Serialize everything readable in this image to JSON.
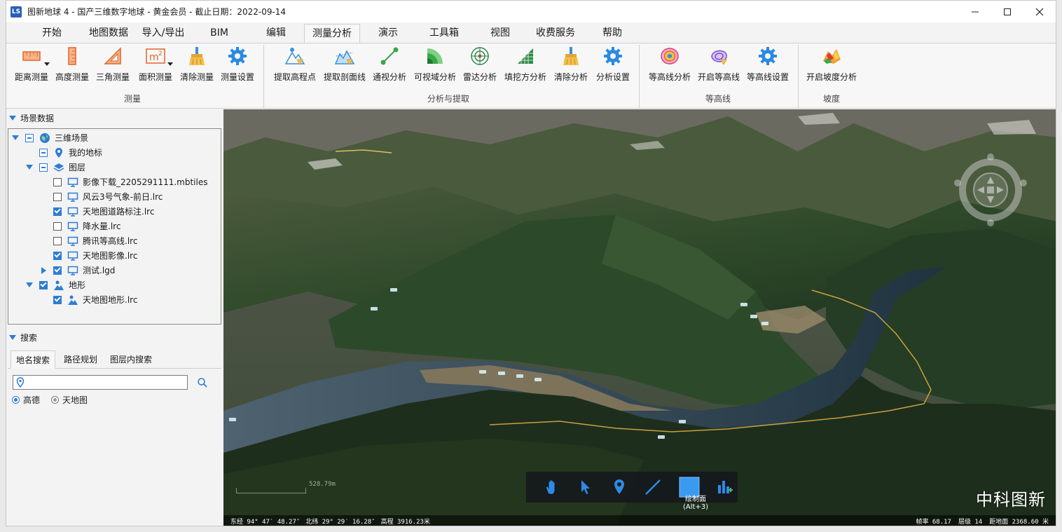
{
  "window": {
    "title": "图新地球 4 - 国产三维数字地球 - 黄金会员 - 截止日期：2022-09-14",
    "icon_text": "LS",
    "controls": [
      "minimize-icon",
      "maximize-icon",
      "close-icon"
    ]
  },
  "menu": {
    "tabs": [
      "开始",
      "地图数据",
      "导入/导出",
      "BIM",
      "编辑",
      "测量分析",
      "演示",
      "工具箱",
      "视图",
      "收费服务",
      "帮助"
    ],
    "active": "测量分析"
  },
  "ribbon": {
    "buttons": [
      "距离测量",
      "高度测量",
      "三角测量",
      "面积测量",
      "清除测量",
      "测量设置",
      "提取高程点",
      "提取剖面线",
      "通视分析",
      "可视域分析",
      "雷达分析",
      "填挖方分析",
      "清除分析",
      "分析设置",
      "等高线分析",
      "开启等高线",
      "等高线设置",
      "开启坡度分析"
    ],
    "groups": [
      "测量",
      "分析与提取",
      "等高线",
      "坡度"
    ]
  },
  "scene_panel": {
    "title": "场景数据",
    "root": "三维场景",
    "items": [
      {
        "label": "我的地标"
      },
      {
        "label": "图层"
      },
      {
        "label": "影像下载_2205291111.mbtiles",
        "checked": false
      },
      {
        "label": "风云3号气象-前日.lrc",
        "checked": false
      },
      {
        "label": "天地图道路标注.lrc",
        "checked": true
      },
      {
        "label": "降水量.lrc",
        "checked": false
      },
      {
        "label": "腾讯等高线.lrc",
        "checked": false
      },
      {
        "label": "天地图影像.lrc",
        "checked": true
      },
      {
        "label": "测试.lgd",
        "checked": true
      },
      {
        "label": "地形",
        "checked": true
      },
      {
        "label": "天地图地形.lrc",
        "checked": true
      }
    ]
  },
  "search_panel": {
    "title": "搜索",
    "tabs": [
      "地名搜索",
      "路径规划",
      "图层内搜索"
    ],
    "active_tab": "地名搜索",
    "input_value": "",
    "providers": [
      "高德",
      "天地图"
    ],
    "selected_provider": "高德"
  },
  "map": {
    "scale_label": "528.79m",
    "status": {
      "longitude": "东经 94° 47′ 48.27″",
      "latitude": "北纬 29° 29′ 16.28″",
      "elevation": "高程 3916.23米",
      "fps": "帧率 68.17",
      "level": "层级 14",
      "distance": "距地面 2368.60 米"
    },
    "toolbar": {
      "tooltip_title": "绘制面",
      "tooltip_shortcut": "(Alt+3)"
    },
    "watermark": "中科图新"
  }
}
